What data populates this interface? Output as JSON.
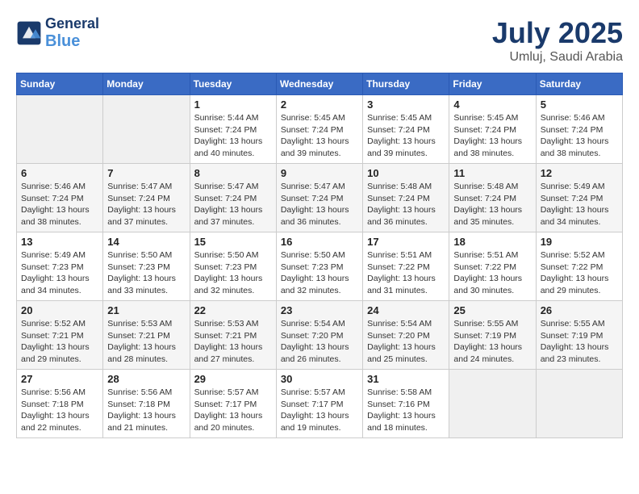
{
  "header": {
    "logo_line1": "General",
    "logo_line2": "Blue",
    "title": "July 2025",
    "subtitle": "Umluj, Saudi Arabia"
  },
  "weekdays": [
    "Sunday",
    "Monday",
    "Tuesday",
    "Wednesday",
    "Thursday",
    "Friday",
    "Saturday"
  ],
  "weeks": [
    [
      {
        "day": "",
        "info": ""
      },
      {
        "day": "",
        "info": ""
      },
      {
        "day": "1",
        "info": "Sunrise: 5:44 AM\nSunset: 7:24 PM\nDaylight: 13 hours and 40 minutes."
      },
      {
        "day": "2",
        "info": "Sunrise: 5:45 AM\nSunset: 7:24 PM\nDaylight: 13 hours and 39 minutes."
      },
      {
        "day": "3",
        "info": "Sunrise: 5:45 AM\nSunset: 7:24 PM\nDaylight: 13 hours and 39 minutes."
      },
      {
        "day": "4",
        "info": "Sunrise: 5:45 AM\nSunset: 7:24 PM\nDaylight: 13 hours and 38 minutes."
      },
      {
        "day": "5",
        "info": "Sunrise: 5:46 AM\nSunset: 7:24 PM\nDaylight: 13 hours and 38 minutes."
      }
    ],
    [
      {
        "day": "6",
        "info": "Sunrise: 5:46 AM\nSunset: 7:24 PM\nDaylight: 13 hours and 38 minutes."
      },
      {
        "day": "7",
        "info": "Sunrise: 5:47 AM\nSunset: 7:24 PM\nDaylight: 13 hours and 37 minutes."
      },
      {
        "day": "8",
        "info": "Sunrise: 5:47 AM\nSunset: 7:24 PM\nDaylight: 13 hours and 37 minutes."
      },
      {
        "day": "9",
        "info": "Sunrise: 5:47 AM\nSunset: 7:24 PM\nDaylight: 13 hours and 36 minutes."
      },
      {
        "day": "10",
        "info": "Sunrise: 5:48 AM\nSunset: 7:24 PM\nDaylight: 13 hours and 36 minutes."
      },
      {
        "day": "11",
        "info": "Sunrise: 5:48 AM\nSunset: 7:24 PM\nDaylight: 13 hours and 35 minutes."
      },
      {
        "day": "12",
        "info": "Sunrise: 5:49 AM\nSunset: 7:24 PM\nDaylight: 13 hours and 34 minutes."
      }
    ],
    [
      {
        "day": "13",
        "info": "Sunrise: 5:49 AM\nSunset: 7:23 PM\nDaylight: 13 hours and 34 minutes."
      },
      {
        "day": "14",
        "info": "Sunrise: 5:50 AM\nSunset: 7:23 PM\nDaylight: 13 hours and 33 minutes."
      },
      {
        "day": "15",
        "info": "Sunrise: 5:50 AM\nSunset: 7:23 PM\nDaylight: 13 hours and 32 minutes."
      },
      {
        "day": "16",
        "info": "Sunrise: 5:50 AM\nSunset: 7:23 PM\nDaylight: 13 hours and 32 minutes."
      },
      {
        "day": "17",
        "info": "Sunrise: 5:51 AM\nSunset: 7:22 PM\nDaylight: 13 hours and 31 minutes."
      },
      {
        "day": "18",
        "info": "Sunrise: 5:51 AM\nSunset: 7:22 PM\nDaylight: 13 hours and 30 minutes."
      },
      {
        "day": "19",
        "info": "Sunrise: 5:52 AM\nSunset: 7:22 PM\nDaylight: 13 hours and 29 minutes."
      }
    ],
    [
      {
        "day": "20",
        "info": "Sunrise: 5:52 AM\nSunset: 7:21 PM\nDaylight: 13 hours and 29 minutes."
      },
      {
        "day": "21",
        "info": "Sunrise: 5:53 AM\nSunset: 7:21 PM\nDaylight: 13 hours and 28 minutes."
      },
      {
        "day": "22",
        "info": "Sunrise: 5:53 AM\nSunset: 7:21 PM\nDaylight: 13 hours and 27 minutes."
      },
      {
        "day": "23",
        "info": "Sunrise: 5:54 AM\nSunset: 7:20 PM\nDaylight: 13 hours and 26 minutes."
      },
      {
        "day": "24",
        "info": "Sunrise: 5:54 AM\nSunset: 7:20 PM\nDaylight: 13 hours and 25 minutes."
      },
      {
        "day": "25",
        "info": "Sunrise: 5:55 AM\nSunset: 7:19 PM\nDaylight: 13 hours and 24 minutes."
      },
      {
        "day": "26",
        "info": "Sunrise: 5:55 AM\nSunset: 7:19 PM\nDaylight: 13 hours and 23 minutes."
      }
    ],
    [
      {
        "day": "27",
        "info": "Sunrise: 5:56 AM\nSunset: 7:18 PM\nDaylight: 13 hours and 22 minutes."
      },
      {
        "day": "28",
        "info": "Sunrise: 5:56 AM\nSunset: 7:18 PM\nDaylight: 13 hours and 21 minutes."
      },
      {
        "day": "29",
        "info": "Sunrise: 5:57 AM\nSunset: 7:17 PM\nDaylight: 13 hours and 20 minutes."
      },
      {
        "day": "30",
        "info": "Sunrise: 5:57 AM\nSunset: 7:17 PM\nDaylight: 13 hours and 19 minutes."
      },
      {
        "day": "31",
        "info": "Sunrise: 5:58 AM\nSunset: 7:16 PM\nDaylight: 13 hours and 18 minutes."
      },
      {
        "day": "",
        "info": ""
      },
      {
        "day": "",
        "info": ""
      }
    ]
  ]
}
